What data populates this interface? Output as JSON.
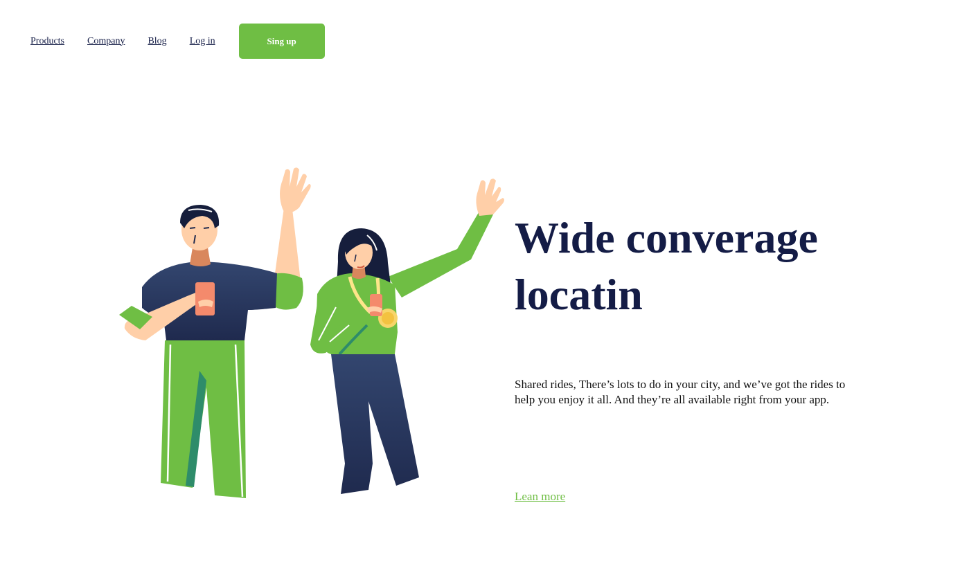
{
  "nav": {
    "items": [
      {
        "label": "Products"
      },
      {
        "label": "Company"
      },
      {
        "label": "Blog"
      },
      {
        "label": "Log in"
      }
    ],
    "signup_label": "Sing up"
  },
  "hero": {
    "title": "Wide converage locatin",
    "description": "Shared rides, There’s lots to do in your city, and we’ve got the rides to help you enjoy it all. And they’re all available right from your app.",
    "link_label": "Lean more"
  },
  "illustration": {
    "icon": "two-people-waving-illustration"
  },
  "colors": {
    "brand_green": "#6fbe44",
    "navy": "#141c46",
    "pants_navy": "#2c3b67",
    "skin": "#ffcfa8",
    "phone": "#f48a6c"
  }
}
